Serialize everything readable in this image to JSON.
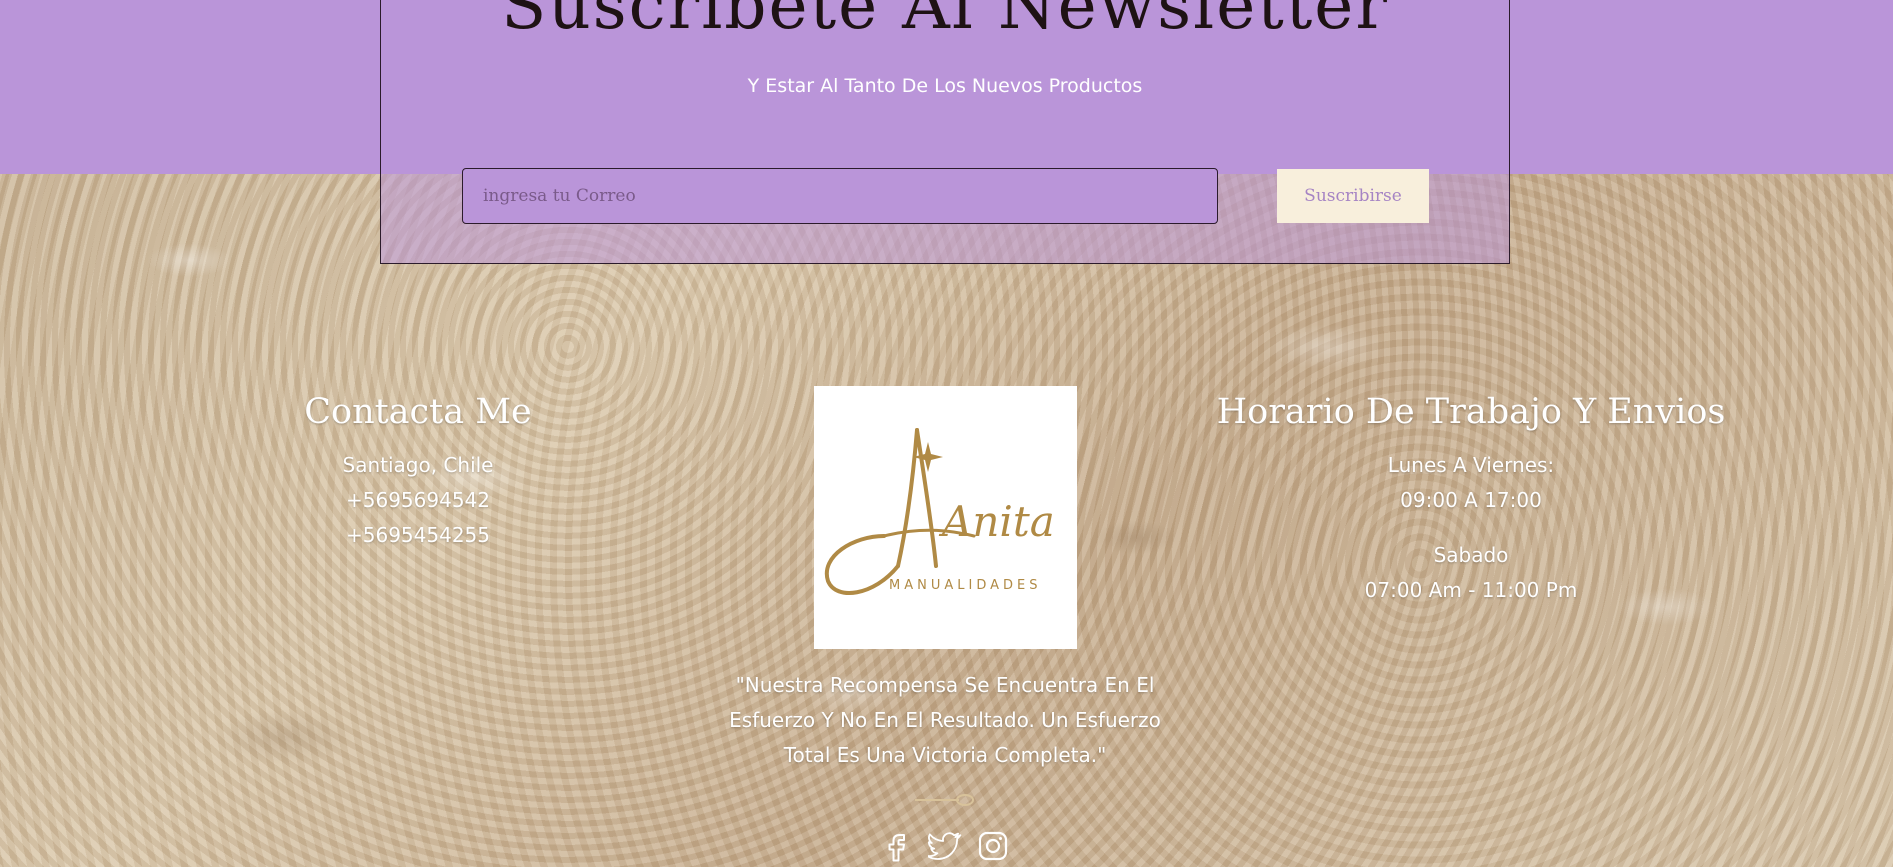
{
  "newsletter": {
    "title": "Suscribete Al Newsletter",
    "subtitle": "Y Estar Al Tanto De Los Nuevos Productos",
    "input_placeholder": "ingresa tu Correo",
    "input_value": "",
    "button_label": "Suscribirse"
  },
  "contact": {
    "heading": "Contacta Me",
    "city": "Santiago, Chile",
    "phone_1": "+5695694542",
    "phone_2": "+5695454255"
  },
  "logo": {
    "brand_name": "Anita",
    "tagline": "MANUALIDADES"
  },
  "quote": {
    "line_1": "\"Nuestra Recompensa Se Encuentra En El",
    "line_2": "Esfuerzo Y No En El Resultado. Un Esfuerzo",
    "line_3": "Total Es Una Victoria Completa.\""
  },
  "hours": {
    "heading": "Horario De Trabajo Y Envios",
    "weekday_label": "Lunes A Viernes:",
    "weekday_time": "09:00 A 17:00",
    "saturday_label": "Sabado",
    "saturday_time": "07:00 Am - 11:00 Pm"
  },
  "social": {
    "icons": [
      "facebook-icon",
      "twitter-icon",
      "instagram-icon"
    ]
  },
  "colors": {
    "purple_band": "#ba95d9",
    "button_bg": "#f8efdc",
    "logo_gold": "#b08a45",
    "text_dark": "#1e1214"
  }
}
